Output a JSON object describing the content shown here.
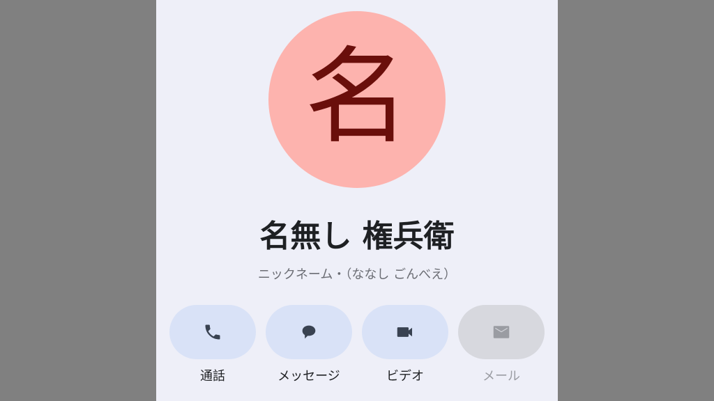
{
  "contact": {
    "avatar_letter": "名",
    "name": "名無し 権兵衛",
    "subtitle": "ニックネーム・（ななし ごんべえ）"
  },
  "actions": [
    {
      "label": "通話",
      "icon": "phone-icon",
      "enabled": true
    },
    {
      "label": "メッセージ",
      "icon": "message-icon",
      "enabled": true
    },
    {
      "label": "ビデオ",
      "icon": "video-icon",
      "enabled": true
    },
    {
      "label": "メール",
      "icon": "mail-icon",
      "enabled": false
    }
  ],
  "colors": {
    "background": "#eeeff8",
    "avatar": "#fdb3ae",
    "avatar_text": "#6a0f0b",
    "action_pill": "#d9e2f7",
    "action_pill_disabled": "#d7d8de",
    "icon": "#394251",
    "icon_disabled": "#9a9ca2"
  }
}
